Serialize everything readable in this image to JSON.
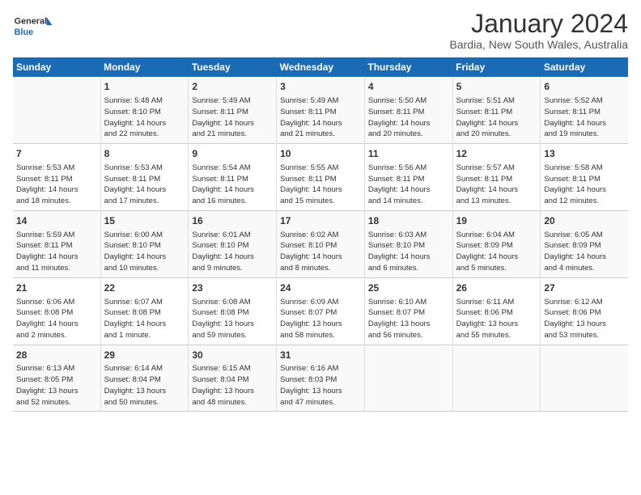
{
  "logo": {
    "line1": "General",
    "line2": "Blue"
  },
  "title": "January 2024",
  "subtitle": "Bardia, New South Wales, Australia",
  "days_header": [
    "Sunday",
    "Monday",
    "Tuesday",
    "Wednesday",
    "Thursday",
    "Friday",
    "Saturday"
  ],
  "weeks": [
    [
      {
        "day": "",
        "content": ""
      },
      {
        "day": "1",
        "content": "Sunrise: 5:48 AM\nSunset: 8:10 PM\nDaylight: 14 hours\nand 22 minutes."
      },
      {
        "day": "2",
        "content": "Sunrise: 5:49 AM\nSunset: 8:11 PM\nDaylight: 14 hours\nand 21 minutes."
      },
      {
        "day": "3",
        "content": "Sunrise: 5:49 AM\nSunset: 8:11 PM\nDaylight: 14 hours\nand 21 minutes."
      },
      {
        "day": "4",
        "content": "Sunrise: 5:50 AM\nSunset: 8:11 PM\nDaylight: 14 hours\nand 20 minutes."
      },
      {
        "day": "5",
        "content": "Sunrise: 5:51 AM\nSunset: 8:11 PM\nDaylight: 14 hours\nand 20 minutes."
      },
      {
        "day": "6",
        "content": "Sunrise: 5:52 AM\nSunset: 8:11 PM\nDaylight: 14 hours\nand 19 minutes."
      }
    ],
    [
      {
        "day": "7",
        "content": "Sunrise: 5:53 AM\nSunset: 8:11 PM\nDaylight: 14 hours\nand 18 minutes."
      },
      {
        "day": "8",
        "content": "Sunrise: 5:53 AM\nSunset: 8:11 PM\nDaylight: 14 hours\nand 17 minutes."
      },
      {
        "day": "9",
        "content": "Sunrise: 5:54 AM\nSunset: 8:11 PM\nDaylight: 14 hours\nand 16 minutes."
      },
      {
        "day": "10",
        "content": "Sunrise: 5:55 AM\nSunset: 8:11 PM\nDaylight: 14 hours\nand 15 minutes."
      },
      {
        "day": "11",
        "content": "Sunrise: 5:56 AM\nSunset: 8:11 PM\nDaylight: 14 hours\nand 14 minutes."
      },
      {
        "day": "12",
        "content": "Sunrise: 5:57 AM\nSunset: 8:11 PM\nDaylight: 14 hours\nand 13 minutes."
      },
      {
        "day": "13",
        "content": "Sunrise: 5:58 AM\nSunset: 8:11 PM\nDaylight: 14 hours\nand 12 minutes."
      }
    ],
    [
      {
        "day": "14",
        "content": "Sunrise: 5:59 AM\nSunset: 8:11 PM\nDaylight: 14 hours\nand 11 minutes."
      },
      {
        "day": "15",
        "content": "Sunrise: 6:00 AM\nSunset: 8:10 PM\nDaylight: 14 hours\nand 10 minutes."
      },
      {
        "day": "16",
        "content": "Sunrise: 6:01 AM\nSunset: 8:10 PM\nDaylight: 14 hours\nand 9 minutes."
      },
      {
        "day": "17",
        "content": "Sunrise: 6:02 AM\nSunset: 8:10 PM\nDaylight: 14 hours\nand 8 minutes."
      },
      {
        "day": "18",
        "content": "Sunrise: 6:03 AM\nSunset: 8:10 PM\nDaylight: 14 hours\nand 6 minutes."
      },
      {
        "day": "19",
        "content": "Sunrise: 6:04 AM\nSunset: 8:09 PM\nDaylight: 14 hours\nand 5 minutes."
      },
      {
        "day": "20",
        "content": "Sunrise: 6:05 AM\nSunset: 8:09 PM\nDaylight: 14 hours\nand 4 minutes."
      }
    ],
    [
      {
        "day": "21",
        "content": "Sunrise: 6:06 AM\nSunset: 8:08 PM\nDaylight: 14 hours\nand 2 minutes."
      },
      {
        "day": "22",
        "content": "Sunrise: 6:07 AM\nSunset: 8:08 PM\nDaylight: 14 hours\nand 1 minute."
      },
      {
        "day": "23",
        "content": "Sunrise: 6:08 AM\nSunset: 8:08 PM\nDaylight: 13 hours\nand 59 minutes."
      },
      {
        "day": "24",
        "content": "Sunrise: 6:09 AM\nSunset: 8:07 PM\nDaylight: 13 hours\nand 58 minutes."
      },
      {
        "day": "25",
        "content": "Sunrise: 6:10 AM\nSunset: 8:07 PM\nDaylight: 13 hours\nand 56 minutes."
      },
      {
        "day": "26",
        "content": "Sunrise: 6:11 AM\nSunset: 8:06 PM\nDaylight: 13 hours\nand 55 minutes."
      },
      {
        "day": "27",
        "content": "Sunrise: 6:12 AM\nSunset: 8:06 PM\nDaylight: 13 hours\nand 53 minutes."
      }
    ],
    [
      {
        "day": "28",
        "content": "Sunrise: 6:13 AM\nSunset: 8:05 PM\nDaylight: 13 hours\nand 52 minutes."
      },
      {
        "day": "29",
        "content": "Sunrise: 6:14 AM\nSunset: 8:04 PM\nDaylight: 13 hours\nand 50 minutes."
      },
      {
        "day": "30",
        "content": "Sunrise: 6:15 AM\nSunset: 8:04 PM\nDaylight: 13 hours\nand 48 minutes."
      },
      {
        "day": "31",
        "content": "Sunrise: 6:16 AM\nSunset: 8:03 PM\nDaylight: 13 hours\nand 47 minutes."
      },
      {
        "day": "",
        "content": ""
      },
      {
        "day": "",
        "content": ""
      },
      {
        "day": "",
        "content": ""
      }
    ]
  ]
}
